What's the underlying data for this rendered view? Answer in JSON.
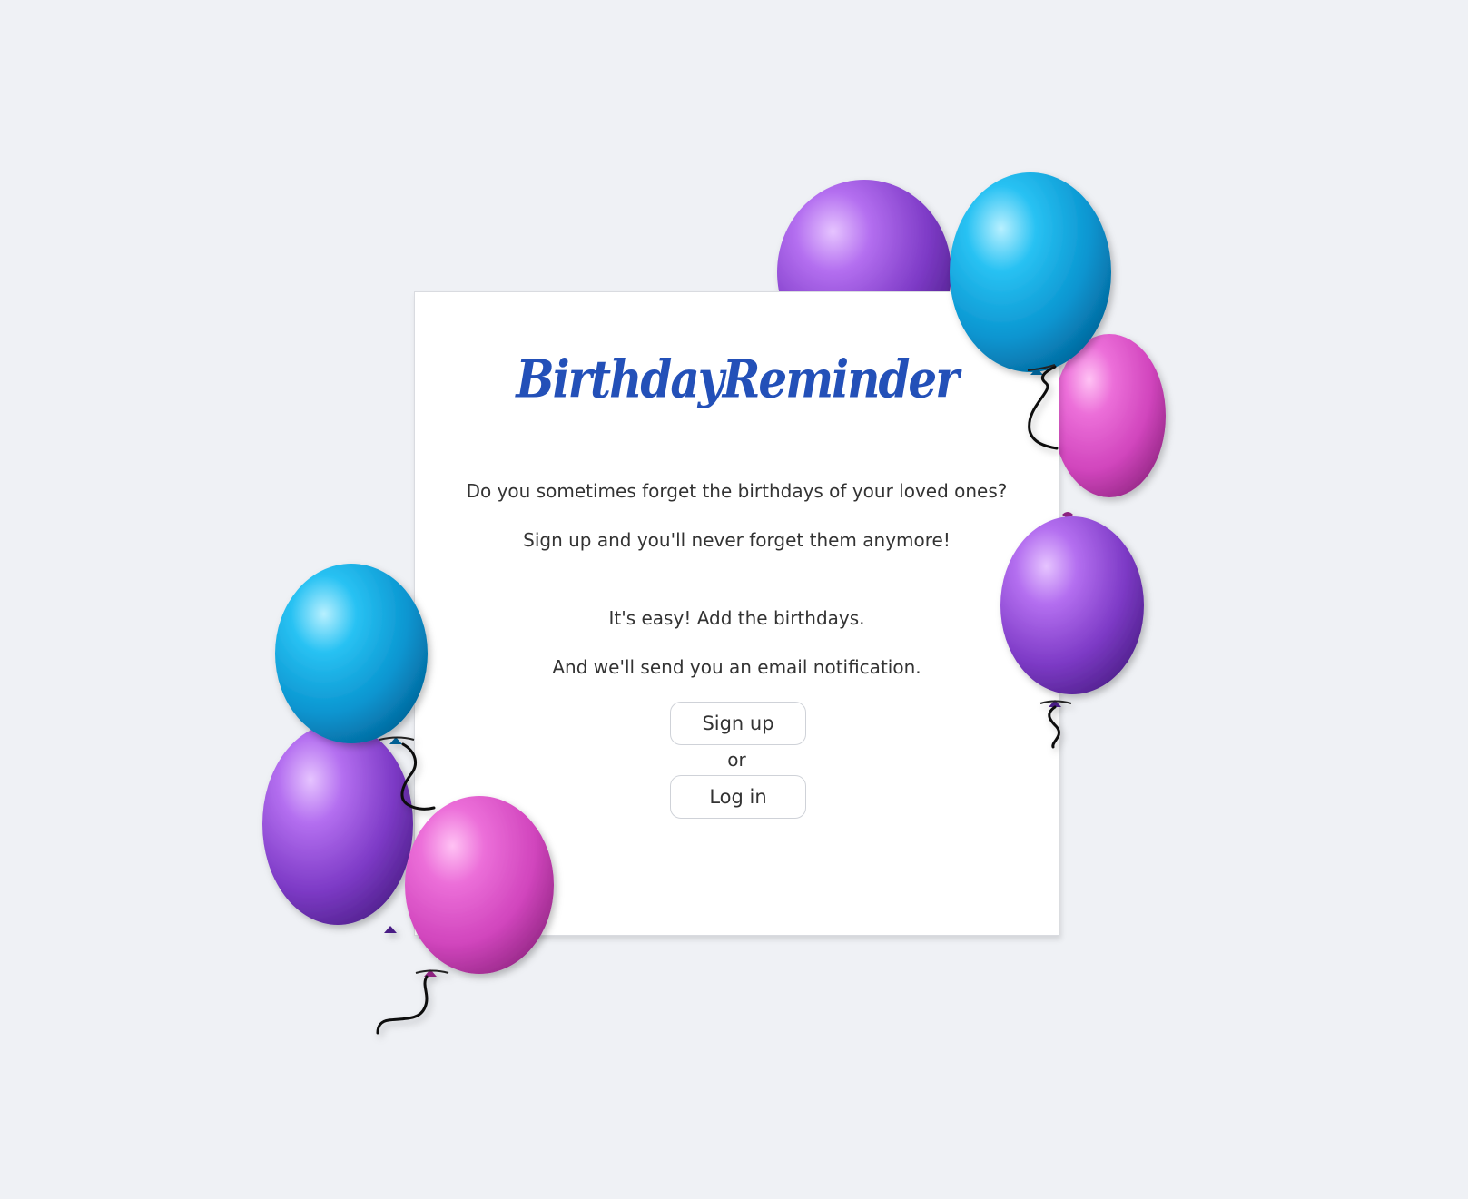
{
  "brand": {
    "logo_text": "BirthdayReminder",
    "logo_color": "#2350b8"
  },
  "intro": {
    "line1": "Do you sometimes forget the birthdays of your loved ones?",
    "line2": "Sign up and you'll never forget them anymore!",
    "line3": "It's easy! Add the birthdays.",
    "line4": "And we'll send you an email notification."
  },
  "actions": {
    "signup_label": "Sign up",
    "or_label": "or",
    "login_label": "Log in"
  },
  "colors": {
    "background": "#eff1f5",
    "card": "#ffffff",
    "balloon_purple": "#8a3fd0",
    "balloon_blue": "#0aa0dc",
    "balloon_pink": "#d548c3"
  },
  "icons": {
    "decoration": "balloon-icon"
  }
}
